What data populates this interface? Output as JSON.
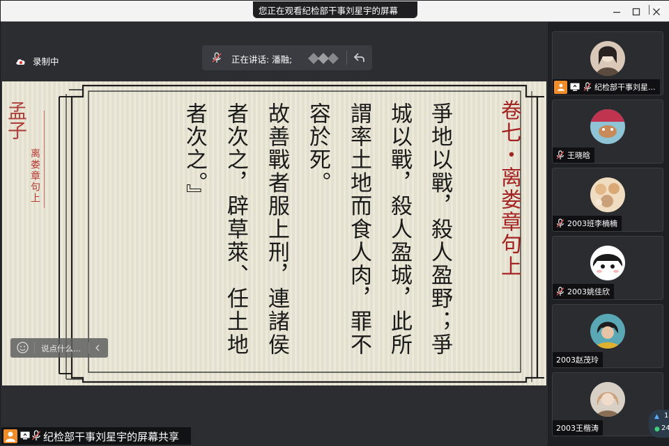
{
  "window": {
    "share_banner": "您正在观看纪检部干事刘星宇的屏幕",
    "controls": {
      "minimize": "—",
      "maximize": "☐",
      "close": "✕"
    }
  },
  "recording": {
    "label": "录制中"
  },
  "speaking": {
    "label": "正在讲话: 潘融;"
  },
  "slide": {
    "chapter_title": "卷七・离娄章句上",
    "side_title": "离娄章句上",
    "side_big": "孟子",
    "columns": [
      "爭地以戰，殺人盈野；爭",
      "城以戰，殺人盈城，此所",
      "謂率土地而食人肉，罪不",
      "容於死。",
      "故善戰者服上刑，連諸侯",
      "者次之，辟草萊、任土地",
      "者次之。』"
    ]
  },
  "chat": {
    "placeholder": "说点什么..."
  },
  "screen_share_label": "纪检部干事刘星宇的屏幕共享",
  "participants": [
    {
      "name": "纪检部干事刘星...",
      "host": true,
      "sharing": true,
      "avatar_bg": "#d9c7b8",
      "avatar_fg": "#2a2220"
    },
    {
      "name": "王晓晗",
      "host": false,
      "sharing": false,
      "avatar_bg": "#8fc4d6",
      "avatar_fg": "#c0344f"
    },
    {
      "name": "2003班李楠楠",
      "host": false,
      "sharing": false,
      "avatar_bg": "#f0dcc0",
      "avatar_fg": "#b78a5e"
    },
    {
      "name": "2003姚佳欣",
      "host": false,
      "sharing": false,
      "avatar_bg": "#ffffff",
      "avatar_fg": "#1a1a1a"
    },
    {
      "name": "2003赵茂玲",
      "host": false,
      "sharing": false,
      "avatar_bg": "#5aa7b5",
      "avatar_fg": "#1d1d1d"
    },
    {
      "name": "2003王楷涛",
      "host": false,
      "sharing": false,
      "avatar_bg": "#d8d0c4",
      "avatar_fg": "#8a6d55"
    }
  ],
  "network": {
    "up": "1",
    "down": "24"
  },
  "colors": {
    "accent": "#f08c2a",
    "title_red": "#a32422",
    "bg": "#2b2d31"
  }
}
